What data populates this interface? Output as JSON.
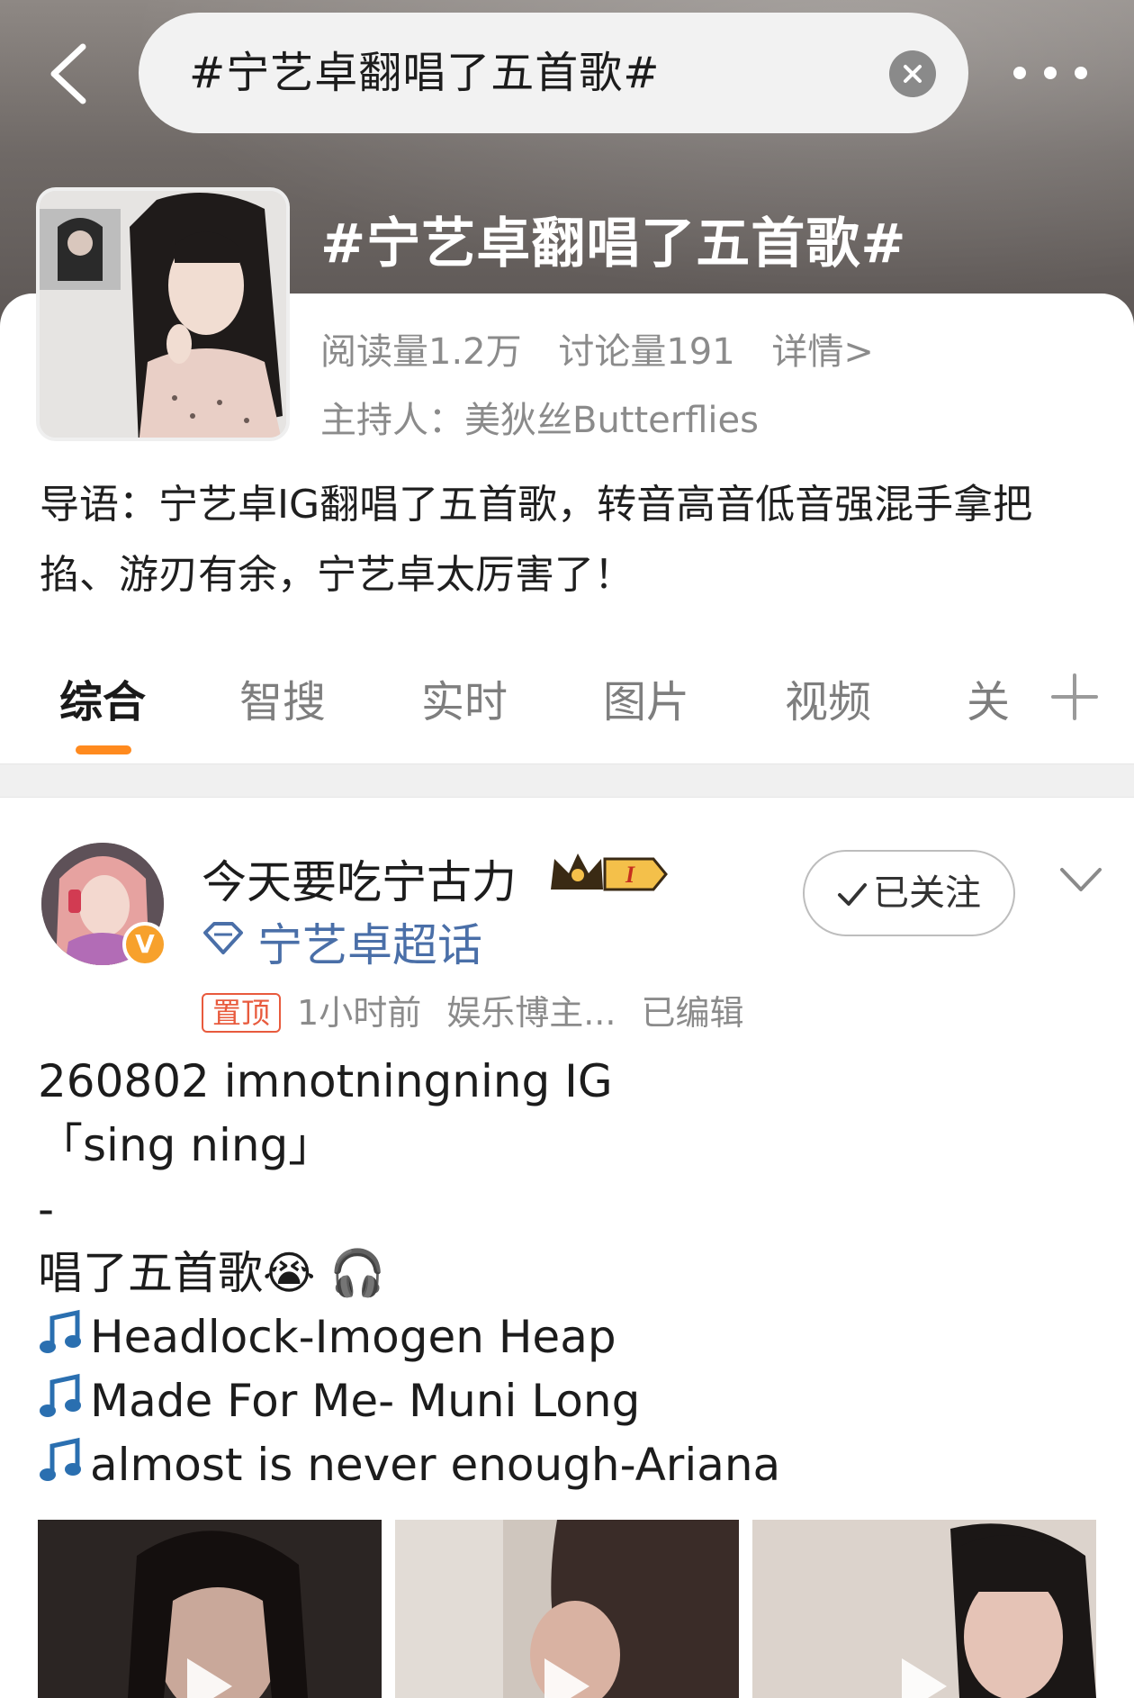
{
  "header": {
    "search_query": "#宁艺卓翻唱了五首歌#"
  },
  "topic": {
    "title": "#宁艺卓翻唱了五首歌#",
    "reads": "阅读量1.2万",
    "discussions": "讨论量191",
    "details_link": "详情>",
    "host": "主持人：美狄丝Butterflies",
    "intro": "导语：宁艺卓IG翻唱了五首歌，转音高音低音强混手拿把掐、游刃有余，宁艺卓太厉害了！"
  },
  "tabs": [
    {
      "label": "综合",
      "active": true
    },
    {
      "label": "智搜",
      "active": false
    },
    {
      "label": "实时",
      "active": false
    },
    {
      "label": "图片",
      "active": false
    },
    {
      "label": "视频",
      "active": false
    },
    {
      "label": "关",
      "active": false
    }
  ],
  "post": {
    "author": "今天要吃宁古力",
    "badge_text": "I",
    "supertopic": "宁艺卓超话",
    "follow_label": "已关注",
    "pin_label": "置顶",
    "time": "1小时前",
    "source": "娱乐博主...",
    "edited": "已编辑",
    "lines": {
      "l1": "260802 imnotningning IG",
      "l2": "「sing ning」",
      "l3": "-",
      "l4": "唱了五首歌😭 🎧",
      "l5": "Headlock-Imogen Heap",
      "l6": "Made For Me- Muni Long",
      "l7": "almost is never enough-Ariana"
    }
  },
  "colors": {
    "accent": "#ff8a1e",
    "link": "#4a6fa8",
    "pin": "#e85a3d",
    "verified": "#f7a12c"
  },
  "icons": [
    "back-icon",
    "clear-icon",
    "more-icon",
    "add-tab-icon",
    "diamond-icon",
    "check-icon",
    "chevron-down-icon",
    "music-note-icon",
    "play-icon",
    "crown-icon"
  ]
}
